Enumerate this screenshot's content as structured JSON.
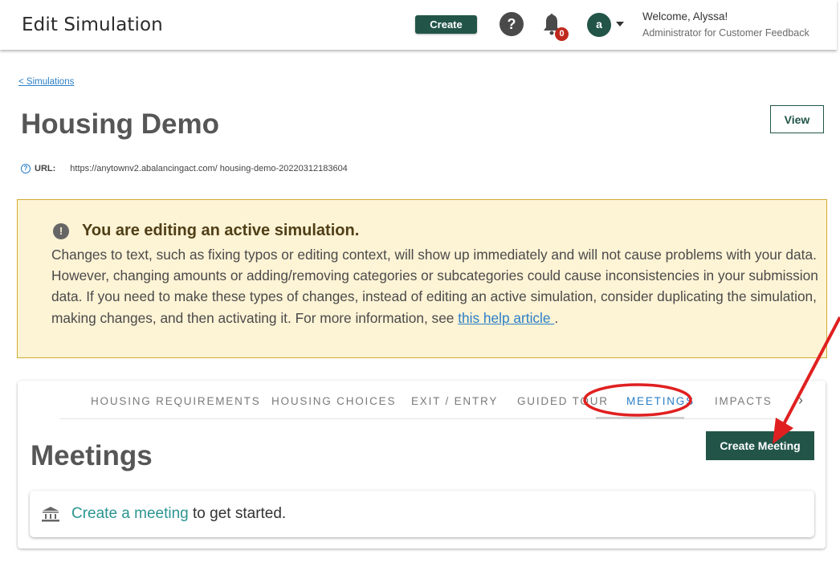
{
  "header": {
    "title": "Edit Simulation",
    "create_label": "Create",
    "help_label": "?",
    "notification_count": "0",
    "avatar_initial": "a",
    "welcome": "Welcome, Alyssa!",
    "role": "Administrator for Customer Feedback"
  },
  "page": {
    "breadcrumb": "< Simulations",
    "title": "Housing Demo",
    "view_label": "View",
    "url_label": "URL:",
    "url_value": "https://anytownv2.abalancingact.com/ housing-demo-20220312183604"
  },
  "alert": {
    "title": "You are editing an active simulation.",
    "body": "Changes to text, such as fixing typos or editing context, will show up immediately and will not cause problems with your data. However, changing amounts or adding/removing categories or subcategories could cause inconsistencies in your submission data. If you need to make these types of changes, instead of editing an active simulation, consider duplicating the simulation, making changes, and then activating it. For more information, see ",
    "link": "this help article ",
    "end": "."
  },
  "tabs": [
    {
      "label": "HOUSING REQUIREMENTS",
      "active": false
    },
    {
      "label": "HOUSING CHOICES",
      "active": false
    },
    {
      "label": "EXIT / ENTRY",
      "active": false
    },
    {
      "label": "GUIDED TOUR",
      "active": false
    },
    {
      "label": "MEETINGS",
      "active": true
    },
    {
      "label": "IMPACTS",
      "active": false
    }
  ],
  "meetings": {
    "title": "Meetings",
    "create_label": "Create Meeting",
    "empty_link": "Create a meeting",
    "empty_suffix": " to get started."
  },
  "colors": {
    "brand": "#225548",
    "link": "#2a7fc7",
    "alert_bg": "#fdf3d5",
    "alert_border": "#d2ac2f",
    "annotation": "#e02020"
  }
}
